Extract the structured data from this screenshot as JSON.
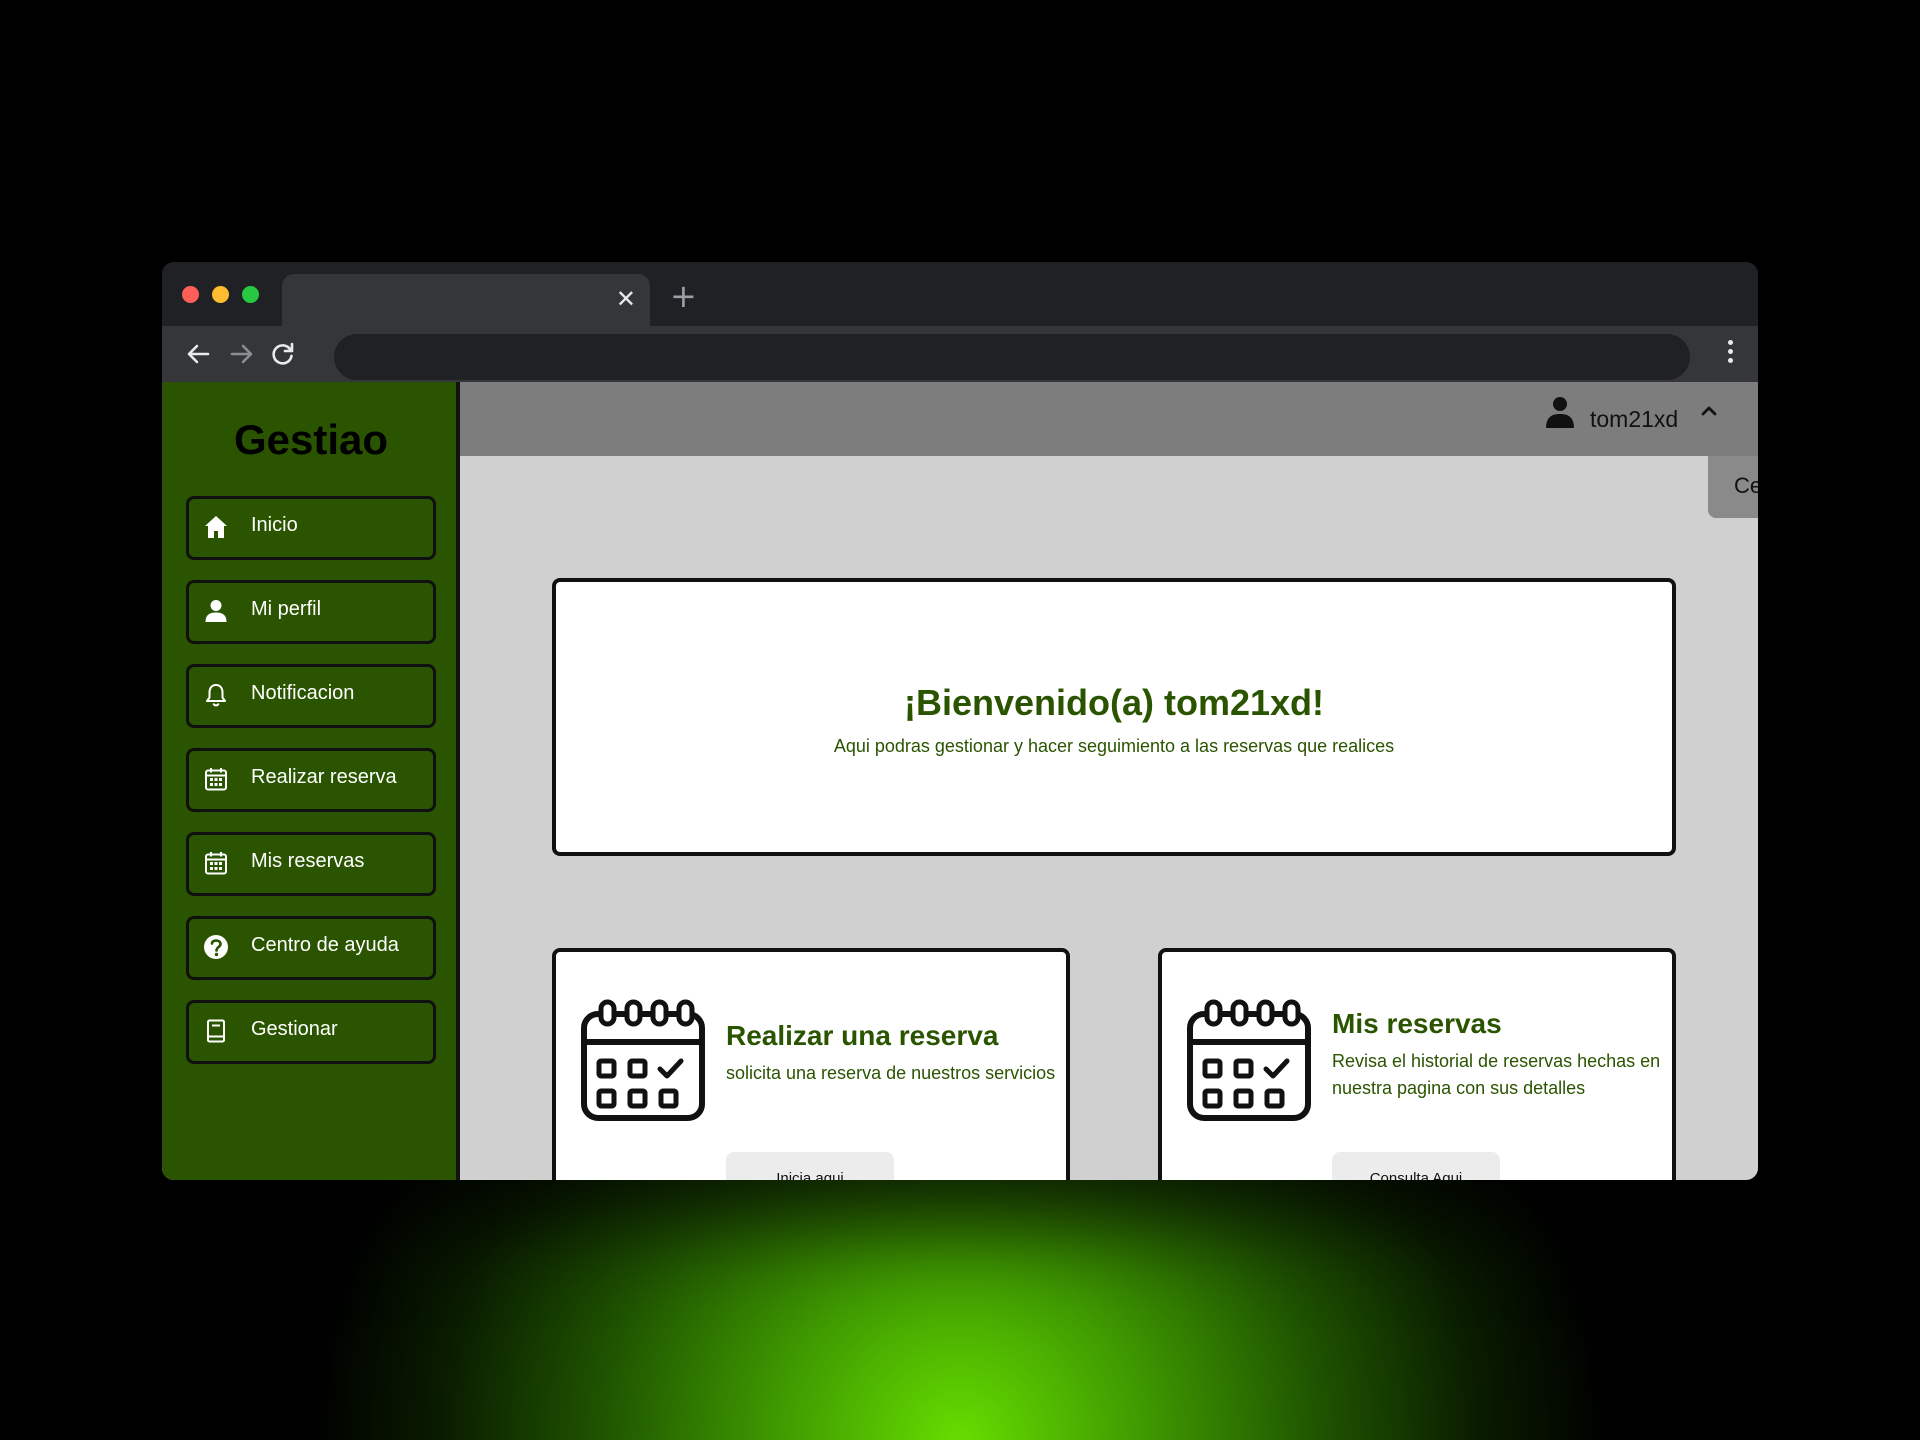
{
  "browser": {
    "tab_close": "✕",
    "new_tab": "+",
    "colors": {
      "close": "#ff5f57",
      "minimize": "#febc2e",
      "maximize": "#28c840"
    }
  },
  "sidebar": {
    "brand": "Gestiao",
    "items": [
      {
        "label": "Inicio",
        "icon": "home-icon"
      },
      {
        "label": "Mi perfil",
        "icon": "user-icon"
      },
      {
        "label": "Notificacion",
        "icon": "bell-icon"
      },
      {
        "label": "Realizar reserva",
        "icon": "calendar-icon"
      },
      {
        "label": "Mis reservas",
        "icon": "calendar-icon"
      },
      {
        "label": "Centro de ayuda",
        "icon": "help-icon"
      },
      {
        "label": "Gestionar",
        "icon": "book-icon"
      }
    ]
  },
  "header": {
    "username": "tom21xd",
    "user_icon": "user-icon",
    "caret_icon": "chevron-up-icon",
    "logout_label": "Cerrar sesión"
  },
  "welcome": {
    "title": "¡Bienvenido(a) tom21xd!",
    "subtitle": "Aqui podras gestionar y hacer seguimiento a las reservas que realices"
  },
  "cards": [
    {
      "title": "Realizar una reserva",
      "text": "solicita una reserva de nuestros servicios",
      "button": "Inicia aqui",
      "icon": "calendar-check-icon"
    },
    {
      "title": "Mis reservas",
      "text": "Revisa el historial de reservas hechas en nuestra pagina con sus detalles",
      "button": "Consulta Aqui",
      "icon": "calendar-check-icon"
    }
  ],
  "colors": {
    "brand_green": "#2a5400",
    "topbar": "#7d7d7d",
    "content_bg": "#d0d0d0"
  }
}
